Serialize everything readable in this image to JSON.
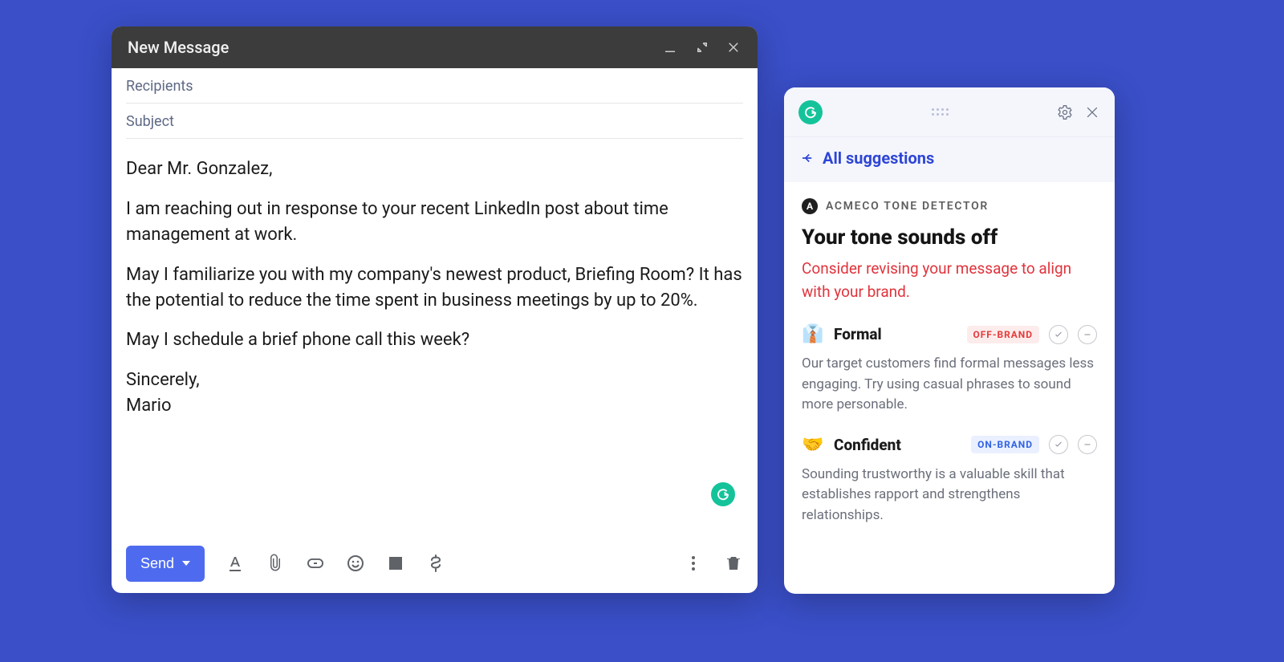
{
  "compose": {
    "title": "New Message",
    "recipients_placeholder": "Recipients",
    "subject_placeholder": "Subject",
    "body_paragraphs": [
      "Dear Mr. Gonzalez,",
      "I am reaching out in response to your recent LinkedIn post about time management at work.",
      "May I familiarize you with my company's newest product, Briefing Room? It has the potential to reduce the time spent in business meetings by up to 20%.",
      "May I schedule a brief phone call this week?",
      "Sincerely,\nMario"
    ],
    "send_label": "Send"
  },
  "panel": {
    "back_label": "All suggestions",
    "detector_badge_letter": "A",
    "detector_label": "ACMECO TONE DETECTOR",
    "tone_title": "Your tone sounds off",
    "tone_warning": "Consider revising your message to align with your brand.",
    "tones": [
      {
        "emoji": "👔",
        "name": "Formal",
        "tag": "OFF-BRAND",
        "tag_class": "off",
        "desc": "Our target customers find formal messages less engaging. Try using casual phrases to sound more personable."
      },
      {
        "emoji": "🤝",
        "name": "Confident",
        "tag": "ON-BRAND",
        "tag_class": "on",
        "desc": "Sounding trustworthy is a valuable skill that establishes rapport and strengthens relationships."
      }
    ]
  }
}
